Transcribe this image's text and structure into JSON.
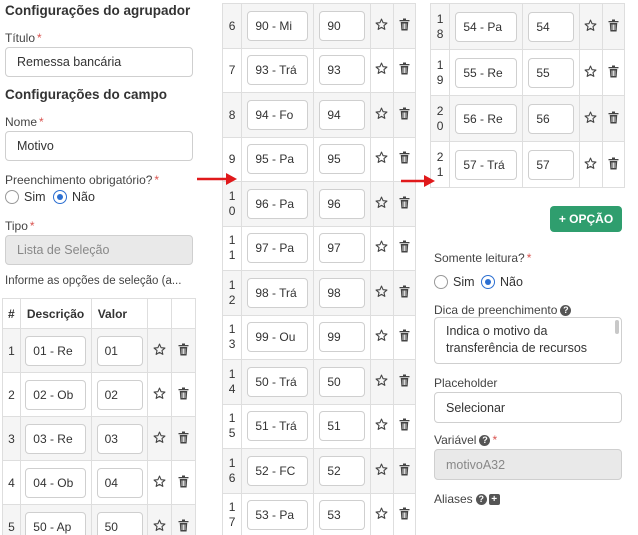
{
  "group_settings": {
    "heading": "Configurações do agrupador",
    "title_label": "Título",
    "title_value": "Remessa bancária"
  },
  "field_settings": {
    "heading": "Configurações do campo",
    "name_label": "Nome",
    "name_value": "Motivo",
    "required_label": "Preenchimento obrigatório?",
    "yes": "Sim",
    "no": "Não",
    "required_selected": "Não",
    "type_label": "Tipo",
    "type_value": "Lista de Seleção",
    "options_hint": "Informe as opções de seleção (a...",
    "table_headers": {
      "index": "#",
      "description": "Descrição",
      "value": "Valor"
    }
  },
  "options_col1": [
    {
      "idx": "1",
      "desc": "01 - Re",
      "val": "01"
    },
    {
      "idx": "2",
      "desc": "02 - Ob",
      "val": "02"
    },
    {
      "idx": "3",
      "desc": "03 - Re",
      "val": "03"
    },
    {
      "idx": "4",
      "desc": "04 - Ob",
      "val": "04"
    },
    {
      "idx": "5",
      "desc": "50 - Ap",
      "val": "50"
    }
  ],
  "options_col2": [
    {
      "idx": "6",
      "desc": "90 - Mi",
      "val": "90"
    },
    {
      "idx": "7",
      "desc": "93 - Trá",
      "val": "93"
    },
    {
      "idx": "8",
      "desc": "94 - Fo",
      "val": "94"
    },
    {
      "idx": "9",
      "desc": "95 - Pa",
      "val": "95"
    },
    {
      "idx": "10",
      "desc": "96 - Pa",
      "val": "96"
    },
    {
      "idx": "11",
      "desc": "97 - Pa",
      "val": "97"
    },
    {
      "idx": "12",
      "desc": "98 - Trá",
      "val": "98"
    },
    {
      "idx": "13",
      "desc": "99 - Ou",
      "val": "99"
    },
    {
      "idx": "14",
      "desc": "50 - Trá",
      "val": "50"
    },
    {
      "idx": "15",
      "desc": "51 - Trá",
      "val": "51"
    },
    {
      "idx": "16",
      "desc": "52 - FC",
      "val": "52"
    },
    {
      "idx": "17",
      "desc": "53 - Pa",
      "val": "53"
    }
  ],
  "options_col3": [
    {
      "idx": "18",
      "desc": "54 - Pa",
      "val": "54"
    },
    {
      "idx": "19",
      "desc": "55 - Re",
      "val": "55"
    },
    {
      "idx": "20",
      "desc": "56 - Re",
      "val": "56"
    },
    {
      "idx": "21",
      "desc": "57 - Trá",
      "val": "57"
    }
  ],
  "add_option_button": "+ OPÇÃO",
  "readonly": {
    "label": "Somente leitura?",
    "yes": "Sim",
    "no": "Não",
    "selected": "Não"
  },
  "hint": {
    "label": "Dica de preenchimento",
    "value": "Indica o motivo da transferência de recursos"
  },
  "placeholder": {
    "label": "Placeholder",
    "value": "Selecionar"
  },
  "variable": {
    "label": "Variável",
    "value": "motivoA32"
  },
  "aliases": {
    "label": "Aliases"
  },
  "colors": {
    "accent": "#2c6fd1",
    "button": "#2f9e6e",
    "required": "#d9534f",
    "arrow": "#e0191b"
  },
  "icons": [
    "star-icon",
    "trash-icon",
    "help-icon",
    "plus-square-icon",
    "arrow-right-icon"
  ]
}
